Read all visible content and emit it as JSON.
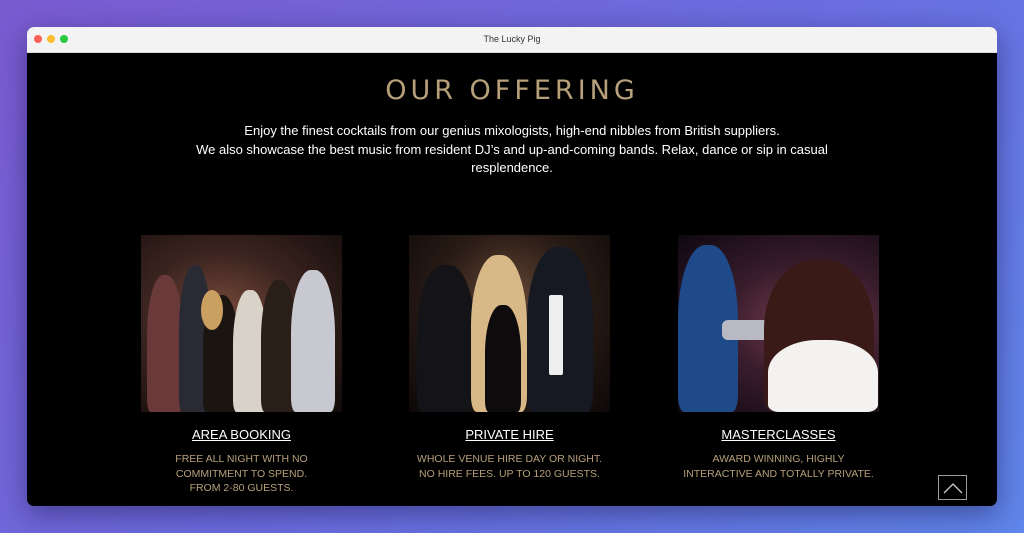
{
  "window": {
    "title": "The Lucky Pig"
  },
  "section": {
    "heading": "OUR OFFERING",
    "intro_line1": "Enjoy the finest cocktails from our genius mixologists, high-end nibbles from British suppliers.",
    "intro_line2": "We also showcase the best music from resident DJ’s and up-and-coming bands. Relax, dance or sip in casual resplendence."
  },
  "cards": [
    {
      "title": "AREA BOOKING",
      "desc": [
        "FREE ALL NIGHT WITH NO",
        "COMMITMENT TO SPEND.",
        "FROM 2-80 GUESTS."
      ]
    },
    {
      "title": "PRIVATE HIRE",
      "desc": [
        "WHOLE VENUE HIRE DAY OR NIGHT.",
        "NO HIRE FEES. UP TO 120 GUESTS."
      ]
    },
    {
      "title": "MASTERCLASSES",
      "desc": [
        "AWARD WINNING, HIGHLY",
        "INTERACTIVE AND TOTALLY PRIVATE."
      ]
    }
  ],
  "colors": {
    "accent_gold": "#b6a07a",
    "background": "#000000",
    "text": "#ffffff"
  },
  "icons": {
    "scroll_top": "chevron-up-icon"
  }
}
